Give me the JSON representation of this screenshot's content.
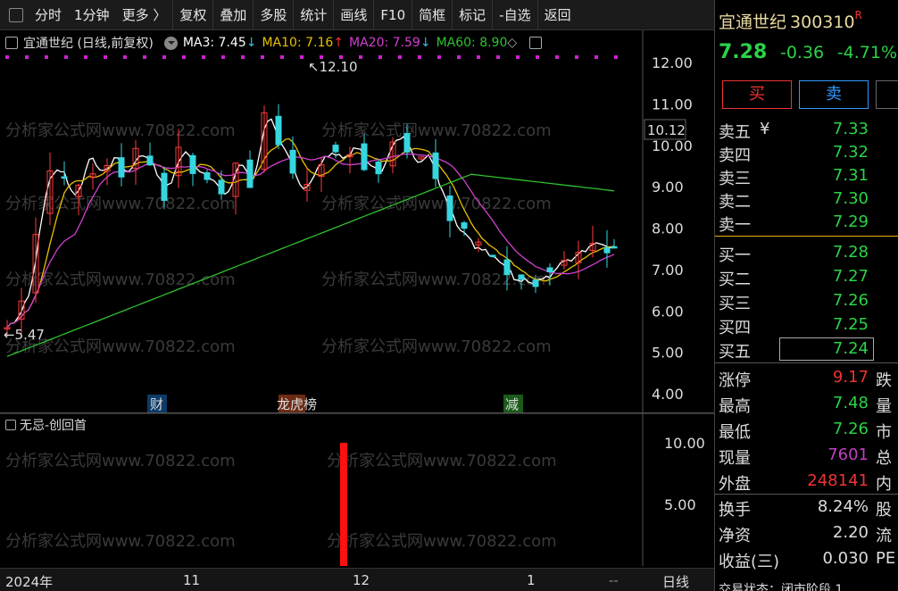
{
  "toolbar": {
    "items": [
      "分时",
      "1分钟",
      "更多 〉",
      "复权",
      "叠加",
      "多股",
      "统计",
      "画线",
      "F10",
      "简框",
      "标记",
      "-自选",
      "返回"
    ]
  },
  "legend": {
    "title": "宜通世纪 (日线,前复权)",
    "ma3": "MA3: 7.45",
    "ma3_arrow": "↓",
    "ma10": "MA10: 7.16",
    "ma10_arrow": "↑",
    "ma20": "MA20: 7.59",
    "ma20_arrow": "↓",
    "ma60": "MA60: 8.90",
    "ma60_arrow": "◇",
    "colors": {
      "ma3": "#ffffff",
      "ma10": "#e8c000",
      "ma20": "#d040d0",
      "ma60": "#30c030"
    }
  },
  "main_axis": {
    "ticks": [
      "12.00",
      "11.00",
      "10.00",
      "9.00",
      "8.00",
      "7.00",
      "6.00",
      "5.00",
      "4.00"
    ],
    "current_price_tag": "10.12",
    "high_label": "12.10",
    "low_label": "5.47"
  },
  "markers": {
    "cai": "财",
    "bang": "龙虎榜",
    "jian": "减"
  },
  "indicator": {
    "name": "无忌-创回首",
    "ticks": [
      "10.00",
      "5.00"
    ],
    "bar_value": 10
  },
  "watermark": "分析家公式网www.70822.com",
  "datebar": {
    "labels": [
      "2024年",
      "11",
      "12",
      "1",
      "--"
    ],
    "line_mode": "日线"
  },
  "panel": {
    "name": "宜通世纪",
    "code": "300310",
    "badge": "R",
    "price": "7.28",
    "change": "-0.36",
    "change_pct": "-4.71%",
    "buy_label": "买",
    "sell_label": "卖",
    "asks": [
      {
        "label": "卖五",
        "extra": "¥",
        "price": "7.33"
      },
      {
        "label": "卖四",
        "extra": "",
        "price": "7.32"
      },
      {
        "label": "卖三",
        "extra": "",
        "price": "7.31"
      },
      {
        "label": "卖二",
        "extra": "",
        "price": "7.30"
      },
      {
        "label": "卖一",
        "extra": "",
        "price": "7.29"
      }
    ],
    "bids": [
      {
        "label": "买一",
        "price": "7.28"
      },
      {
        "label": "买二",
        "price": "7.27"
      },
      {
        "label": "买三",
        "price": "7.26"
      },
      {
        "label": "买四",
        "price": "7.25"
      },
      {
        "label": "买五",
        "price": "7.24"
      }
    ],
    "stats": [
      {
        "label": "涨停",
        "value": "9.17",
        "side": "跌",
        "color": "#e33"
      },
      {
        "label": "最高",
        "value": "7.48",
        "side": "量",
        "color": "#2bd24a"
      },
      {
        "label": "最低",
        "value": "7.26",
        "side": "市",
        "color": "#2bd24a"
      },
      {
        "label": "现量",
        "value": "7601",
        "side": "总",
        "color": "#c040c0"
      },
      {
        "label": "外盘",
        "value": "248141",
        "side": "内",
        "color": "#e33"
      }
    ],
    "stats2": [
      {
        "label": "换手",
        "value": "8.24%",
        "side": "股",
        "color": "#ddd"
      },
      {
        "label": "净资",
        "value": "2.20",
        "side": "流",
        "color": "#ddd"
      },
      {
        "label": "收益(三)",
        "value": "0.030",
        "side": "PE",
        "color": "#ddd"
      }
    ],
    "footer": "交易状态：闭市阶段 1"
  }
}
